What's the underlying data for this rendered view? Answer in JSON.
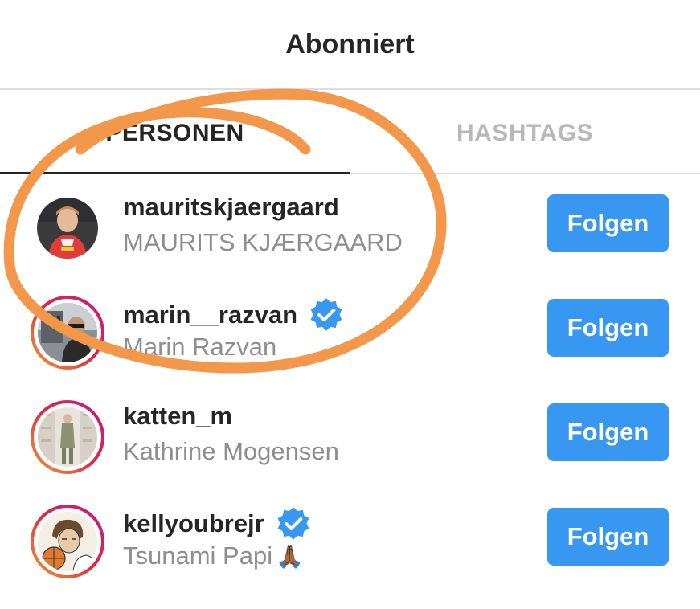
{
  "header": {
    "title": "Abonniert"
  },
  "tabs": [
    {
      "label": "PERSONEN",
      "active": true
    },
    {
      "label": "HASHTAGS",
      "active": false
    }
  ],
  "users": [
    {
      "username": "mauritskjaergaard",
      "full_name": "MAURITS KJÆRGAARD",
      "verified": false,
      "story_ring": false,
      "button": "Folgen"
    },
    {
      "username": "marin__razvan",
      "full_name": "Marin Razvan",
      "verified": true,
      "story_ring": true,
      "button": "Folgen"
    },
    {
      "username": "katten_m",
      "full_name": "Kathrine Mogensen",
      "verified": false,
      "story_ring": true,
      "button": "Folgen"
    },
    {
      "username": "kellyoubrejr",
      "full_name": "Tsunami Papi",
      "full_name_emoji": "🙏🏾",
      "verified": true,
      "story_ring": true,
      "button": "Folgen"
    }
  ],
  "colors": {
    "button_blue": "#3897f0",
    "verified_blue": "#3897f0",
    "annotation_orange": "#f3974a"
  }
}
